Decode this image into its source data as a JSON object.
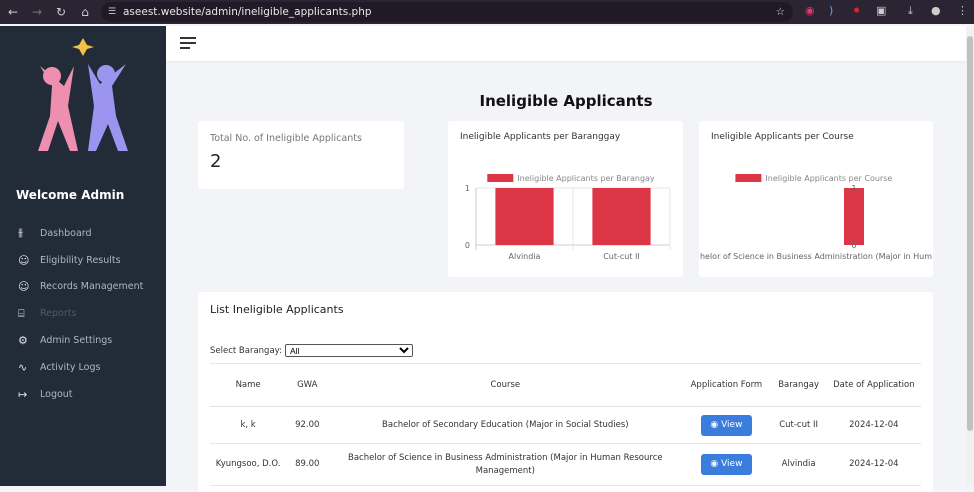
{
  "browser": {
    "url": "aseest.website/admin/ineligible_applicants.php"
  },
  "sidebar": {
    "welcome": "Welcome Admin",
    "items": [
      {
        "label": "Dashboard",
        "icon": "sliders-icon",
        "disabled": false
      },
      {
        "label": "Eligibility Results",
        "icon": "users-icon",
        "disabled": false
      },
      {
        "label": "Records Management",
        "icon": "users-icon",
        "disabled": false
      },
      {
        "label": "Reports",
        "icon": "file-text-icon",
        "disabled": true
      },
      {
        "label": "Admin Settings",
        "icon": "gear-icon",
        "disabled": false
      },
      {
        "label": "Activity Logs",
        "icon": "activity-icon",
        "disabled": false
      },
      {
        "label": "Logout",
        "icon": "logout-icon",
        "disabled": false
      }
    ]
  },
  "main": {
    "title": "Ineligible Applicants",
    "total": {
      "label": "Total No. of Ineligible Applicants",
      "value": "2"
    },
    "list": {
      "title": "List Ineligible Applicants",
      "filter_label": "Select Barangay:",
      "filter_value": "All",
      "columns": [
        "Name",
        "GWA",
        "Course",
        "Application Form",
        "Barangay",
        "Date of Application"
      ],
      "view_label": "View",
      "rows": [
        {
          "name": "k, k",
          "gwa": "92.00",
          "course": "Bachelor of Secondary Education (Major in Social Studies)",
          "barangay": "Cut-cut II",
          "date": "2024-12-04"
        },
        {
          "name": "Kyungsoo, D.O.",
          "gwa": "89.00",
          "course": "Bachelor of Science in Business Administration (Major in Human Resource Management)",
          "barangay": "Alvindia",
          "date": "2024-12-04"
        }
      ]
    }
  },
  "chart_data": [
    {
      "type": "bar",
      "title": "Ineligible Applicants per Baranggay",
      "categories": [
        "Alvindia",
        "Cut-cut II"
      ],
      "series": [
        {
          "name": "Ineligible Applicants per Barangay",
          "values": [
            1,
            1
          ]
        }
      ],
      "ylim": [
        0,
        1
      ],
      "yticks": [
        "0",
        "1"
      ],
      "color": "#dc3545",
      "grid": true,
      "legend": "top"
    },
    {
      "type": "bar",
      "title": "Ineligible Applicants per Course",
      "categories": [
        "helor of Science in Business Administration (Major in Hum"
      ],
      "series": [
        {
          "name": "Ineligible Applicants per Course",
          "values": [
            1
          ]
        }
      ],
      "ylim": [
        0,
        1
      ],
      "yticks": [
        "0",
        "1"
      ],
      "color": "#dc3545",
      "grid": false,
      "legend": "top"
    }
  ]
}
